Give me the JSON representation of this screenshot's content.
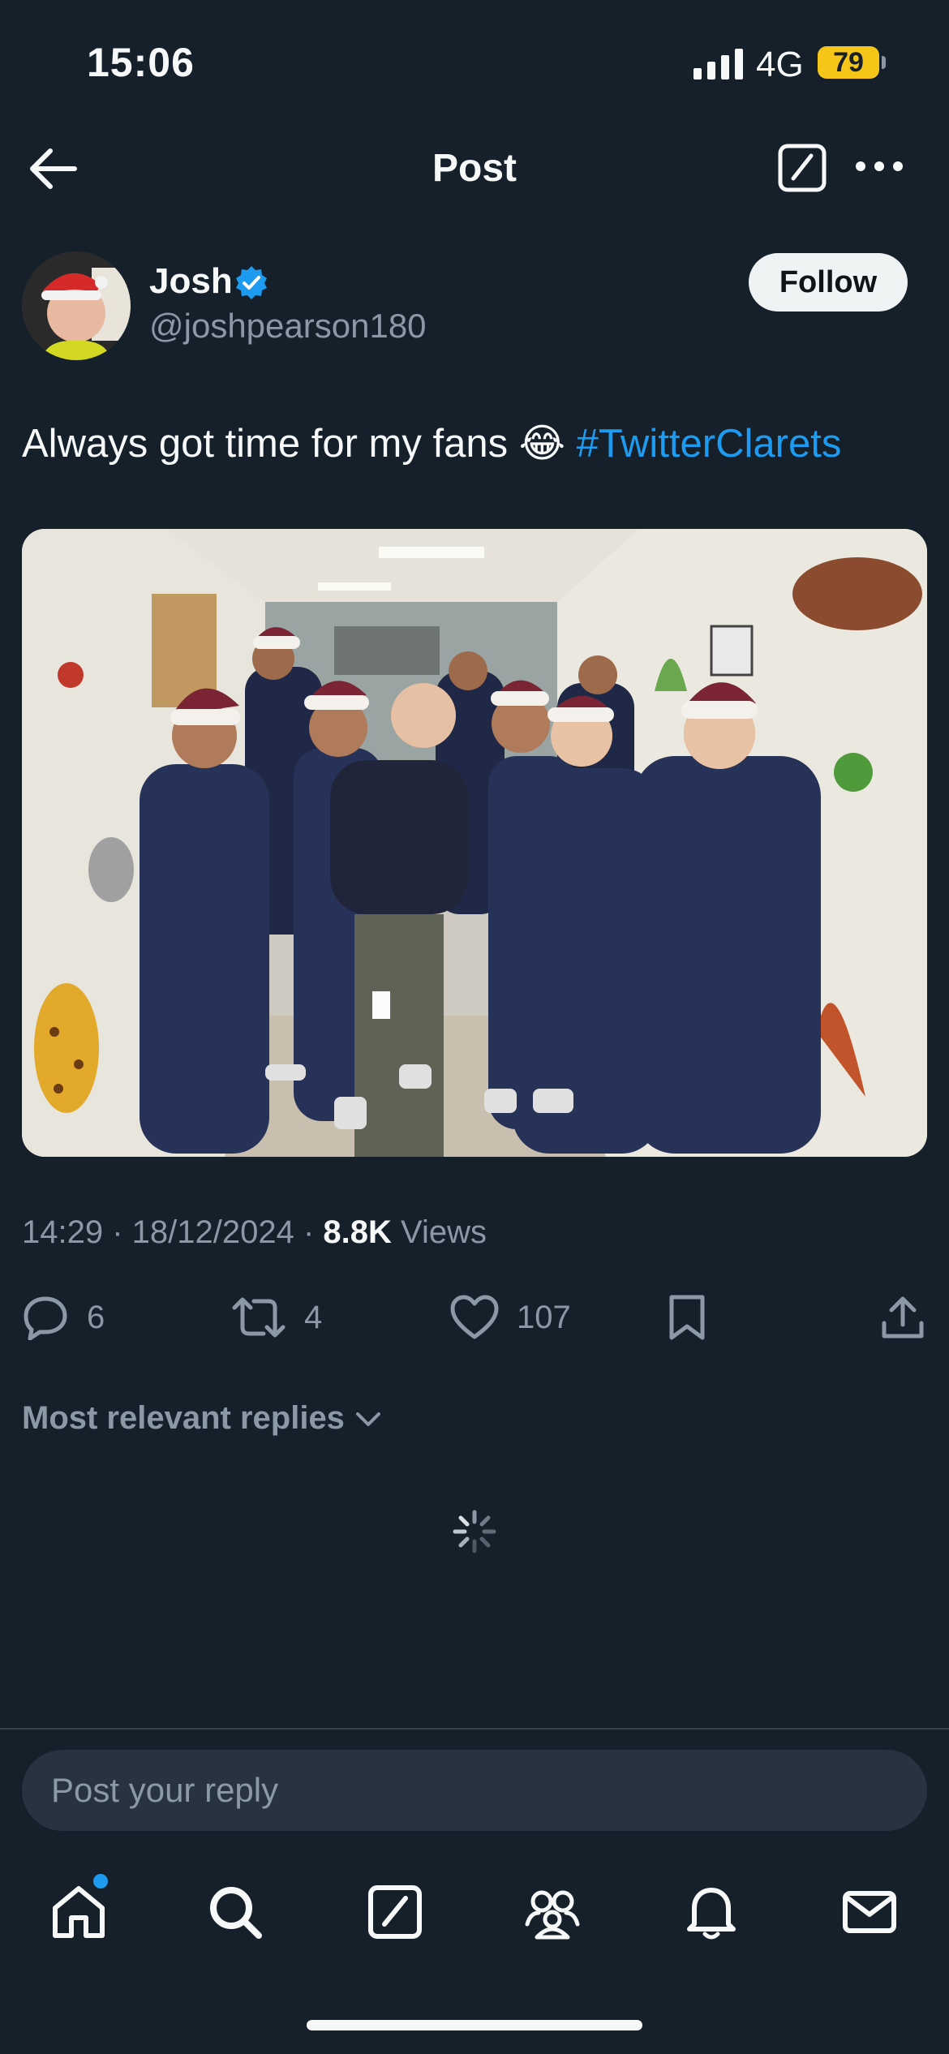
{
  "status_bar": {
    "time": "15:06",
    "network": "4G",
    "battery": "79"
  },
  "header": {
    "title": "Post"
  },
  "author": {
    "name": "Josh",
    "handle": "@joshpearson180",
    "follow_label": "Follow"
  },
  "tweet": {
    "text": "Always got time for my fans 😂 ",
    "hashtag": "#TwitterClarets",
    "time": "14:29",
    "date": "18/12/2024",
    "views_count": "8.8K",
    "views_label": "Views"
  },
  "actions": {
    "replies": "6",
    "retweets": "4",
    "likes": "107"
  },
  "replies": {
    "sort_label": "Most relevant replies"
  },
  "reply_bar": {
    "placeholder": "Post your reply"
  },
  "nav": {
    "items": [
      "home-icon",
      "search-icon",
      "compose-icon",
      "communities-icon",
      "notifications-icon",
      "messages-icon"
    ]
  },
  "colors": {
    "background": "#15202b",
    "accent": "#1d9bf0",
    "muted": "#8b98a5",
    "battery": "#f5c518"
  }
}
